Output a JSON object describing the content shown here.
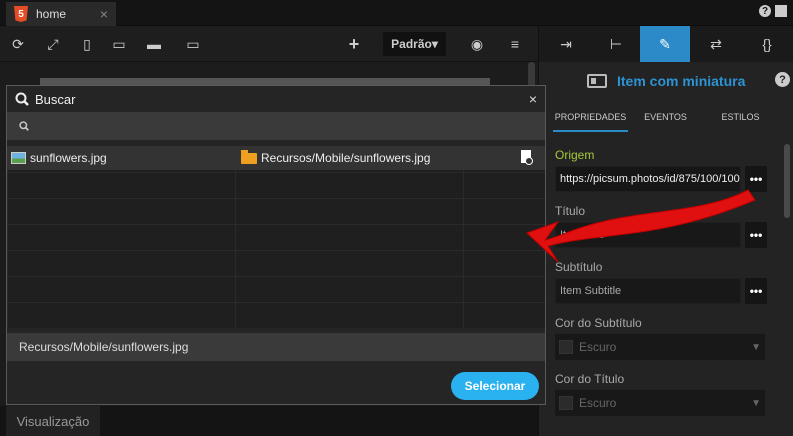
{
  "tabbar": {
    "tab_label": "home",
    "html5_label": "5",
    "help_label": "?"
  },
  "toolbar": {
    "mode_label": "Padrão▾"
  },
  "statusbar": {
    "tab_label": "Visualização"
  },
  "panel": {
    "title": "Item com miniatura",
    "subtabs": [
      "PROPRIEDADES",
      "EVENTOS",
      "ESTILOS"
    ],
    "origem_label": "Origem",
    "origem_value": "https://picsum.photos/id/875/100/100",
    "titulo_label": "Título",
    "titulo_value": "Item Title",
    "subtitulo_label": "Subtítulo",
    "subtitulo_value": "Item Subtitle",
    "cor_subtitulo_label": "Cor do Subtítulo",
    "cor_subtitulo_value": "Escuro",
    "cor_titulo_label": "Cor do Título",
    "cor_titulo_value": "Escuro",
    "dots_label": "•••"
  },
  "dialog": {
    "title": "Buscar",
    "close_label": "×",
    "search_placeholder": "",
    "row": {
      "name": "sunflowers.jpg",
      "path": "Recursos/Mobile/sunflowers.jpg"
    },
    "selected_path": "Recursos/Mobile/sunflowers.jpg",
    "select_button": "Selecionar"
  },
  "colors": {
    "accent": "#2b8ac7",
    "select_button": "#2ab1f0",
    "arrow": "#e01010",
    "highlight": "#a6c93a"
  }
}
